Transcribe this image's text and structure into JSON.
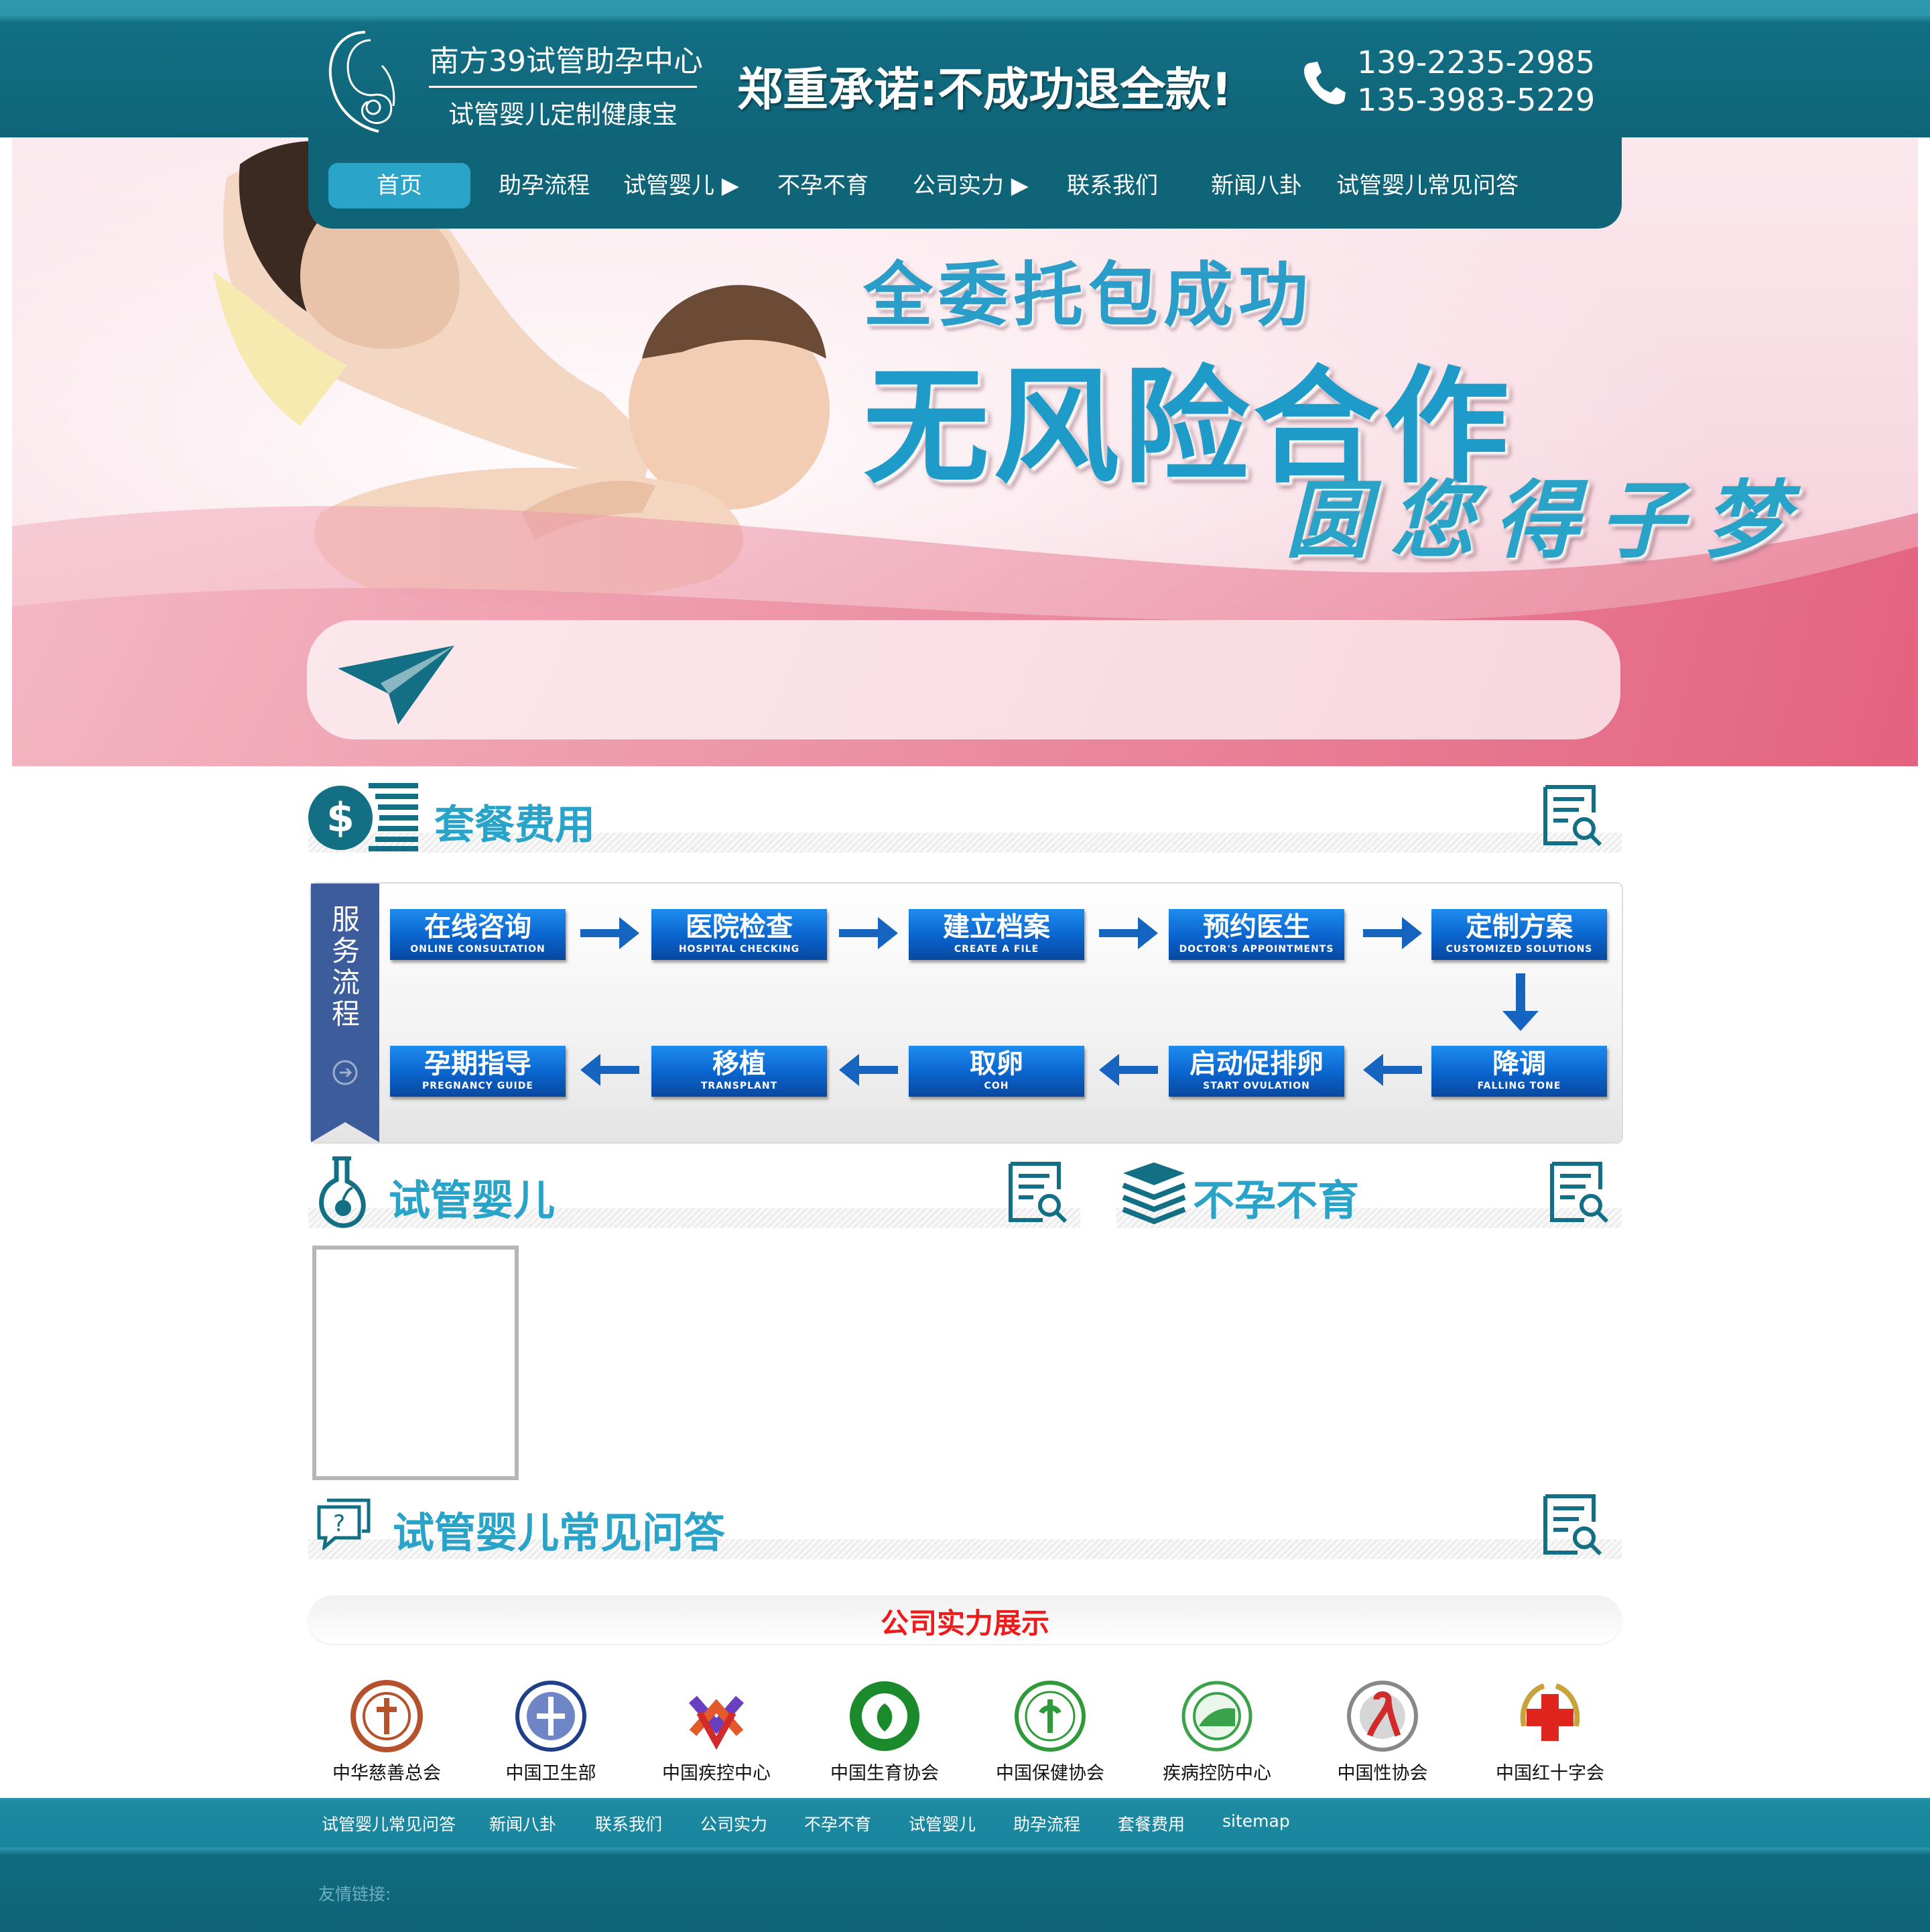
{
  "header": {
    "brand_name": "南方39试管助孕中心",
    "brand_sub": "试管婴儿定制健康宝",
    "promise": "郑重承诺:不成功退全款!",
    "phones": [
      "139-2235-2985",
      "135-3983-5229"
    ]
  },
  "nav": {
    "items": [
      {
        "label": "首页",
        "active": true
      },
      {
        "label": "助孕流程"
      },
      {
        "label": "试管婴儿",
        "has_submenu": true
      },
      {
        "label": "不孕不育"
      },
      {
        "label": "公司实力",
        "has_submenu": true
      },
      {
        "label": "联系我们"
      },
      {
        "label": "新闻八卦"
      },
      {
        "label": "试管婴儿常见问答"
      }
    ]
  },
  "banner": {
    "line1": "全委托包成功",
    "line2": "无风险合作",
    "line3": "圆您得子梦"
  },
  "sections": {
    "package": "套餐费用",
    "ivf": "试管婴儿",
    "infertility": "不孕不育",
    "faq": "试管婴儿常见问答"
  },
  "flow": {
    "side_label": "服务流程",
    "steps": [
      {
        "cn": "在线咨询",
        "en": "ONLINE CONSULTATION"
      },
      {
        "cn": "医院检查",
        "en": "HOSPITAL CHECKING"
      },
      {
        "cn": "建立档案",
        "en": "CREATE A FILE"
      },
      {
        "cn": "预约医生",
        "en": "DOCTOR'S APPOINTMENTS"
      },
      {
        "cn": "定制方案",
        "en": "CUSTOMIZED SOLUTIONS"
      },
      {
        "cn": "降调",
        "en": "FALLING TONE"
      },
      {
        "cn": "启动促排卵",
        "en": "START OVULATION"
      },
      {
        "cn": "取卵",
        "en": "COH"
      },
      {
        "cn": "移植",
        "en": "TRANSPLANT"
      },
      {
        "cn": "孕期指导",
        "en": "PREGNANCY GUIDE"
      }
    ]
  },
  "strength": {
    "title": "公司实力展示",
    "orgs": [
      {
        "name": "中华慈善总会",
        "icon": "charity-logo",
        "color": "#b5522b"
      },
      {
        "name": "中国卫生部",
        "icon": "health-ministry-logo",
        "color": "#1f3f8a"
      },
      {
        "name": "中国疾控中心",
        "icon": "cdc-logo",
        "color": "#6a3fbf"
      },
      {
        "name": "中国生育协会",
        "icon": "birth-assoc-logo",
        "color": "#1a8a2a"
      },
      {
        "name": "中国保健协会",
        "icon": "health-care-logo",
        "color": "#2f9a3a"
      },
      {
        "name": "疾病控防中心",
        "icon": "disease-control-logo",
        "color": "#3aa24a"
      },
      {
        "name": "中国性协会",
        "icon": "sex-assoc-logo",
        "color": "#d02a2a"
      },
      {
        "name": "中国红十字会",
        "icon": "red-cross-logo",
        "color": "#e0251f"
      }
    ]
  },
  "footer": {
    "links": [
      "试管婴儿常见问答",
      "新闻八卦",
      "联系我们",
      "公司实力",
      "不孕不育",
      "试管婴儿",
      "助孕流程",
      "套餐费用",
      "sitemap"
    ],
    "friend_links": "友情链接:"
  },
  "colors": {
    "header_bg": "#0f6478",
    "accent": "#2aa3c9",
    "step_blue": "#0a63cc",
    "strength_red": "#ef1b1b"
  }
}
